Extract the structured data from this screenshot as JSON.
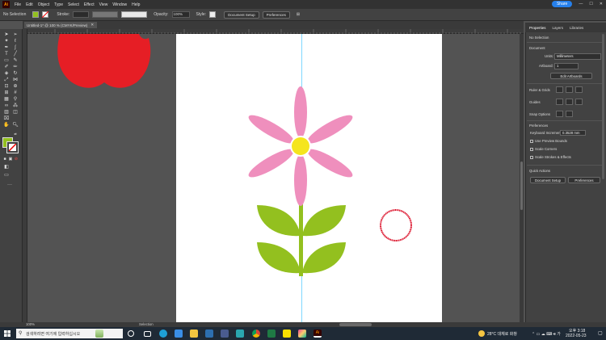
{
  "menubar": {
    "logo": "Ai",
    "items": [
      "File",
      "Edit",
      "Object",
      "Type",
      "Select",
      "Effect",
      "View",
      "Window",
      "Help"
    ],
    "share_label": "Share"
  },
  "controlbar": {
    "selection_label": "No Selection",
    "stroke_label": "Stroke:",
    "opacity_label": "Opacity:",
    "opacity_value": "100%",
    "style_label": "Style:",
    "document_setup": "Document Setup",
    "preferences": "Preferences"
  },
  "document": {
    "tab_title": "Untitled-1* @ 100 % (CMYK/Preview)"
  },
  "panel": {
    "tabs": [
      "Properties",
      "Layers",
      "Libraries"
    ],
    "no_selection": "No Selection",
    "document_heading": "Document",
    "units_label": "Units:",
    "units_value": "Millimeters",
    "artboard_label": "Artboard:",
    "artboard_value": "1",
    "edit_artboards": "Edit Artboards",
    "rulers_grids": "Ruler & Grids",
    "guides": "Guides",
    "snap_options": "Snap Options",
    "preferences_heading": "Preferences",
    "keyboard_increment_label": "Keyboard Increment:",
    "keyboard_increment_value": "0.3528 mm",
    "use_preview_bounds": "Use Preview Bounds",
    "scale_corners": "Scale Corners",
    "scale_strokes": "Scale Strokes & Effects",
    "quick_actions": "Quick Actions",
    "document_setup": "Document Setup",
    "preferences_btn": "Preferences"
  },
  "statusbar": {
    "zoom": "100%",
    "mode": "Selection"
  },
  "taskbar": {
    "search_placeholder": "검색하려면 여기에 입력하십시오",
    "weather": "28°C 대체로 화창",
    "time": "오후 3:18",
    "date": "2022-05-23"
  },
  "colors": {
    "petal": "#ef8fbd",
    "center": "#f5e51d",
    "leaf": "#93c01f",
    "apple": "#e61e25",
    "circle_stroke": "#d9001b",
    "fill_swatch": "#93c01f"
  }
}
